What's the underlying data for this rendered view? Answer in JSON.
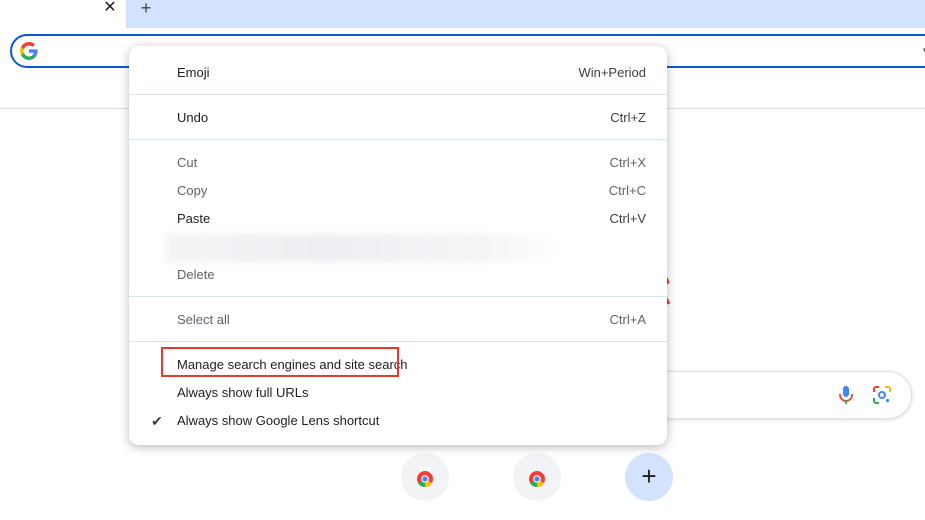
{
  "tabstrip": {
    "close_glyph": "✕",
    "new_tab_glyph": "+"
  },
  "omnibox": {
    "caret_glyph": "▾"
  },
  "shortcuts": {
    "add_glyph": "+"
  },
  "context_menu": {
    "items": [
      {
        "label": "Emoji",
        "shortcut": "Win+Period",
        "enabled": true
      },
      {
        "label": "Undo",
        "shortcut": "Ctrl+Z",
        "enabled": true
      },
      {
        "label": "Cut",
        "shortcut": "Ctrl+X",
        "enabled": false
      },
      {
        "label": "Copy",
        "shortcut": "Ctrl+C",
        "enabled": false
      },
      {
        "label": "Paste",
        "shortcut": "Ctrl+V",
        "enabled": true
      },
      {
        "label": "Delete",
        "shortcut": "",
        "enabled": false
      },
      {
        "label": "Select all",
        "shortcut": "Ctrl+A",
        "enabled": false
      },
      {
        "label": "Manage search engines and site search",
        "shortcut": "",
        "enabled": true,
        "highlighted": true
      },
      {
        "label": "Always show full URLs",
        "shortcut": "",
        "enabled": true
      },
      {
        "label": "Always show Google Lens shortcut",
        "shortcut": "",
        "enabled": true,
        "checked": true
      }
    ],
    "check_glyph": "✔"
  },
  "colors": {
    "highlight": "#e53935",
    "accent": "#0b57d0",
    "tab_strip": "#d3e3fd"
  },
  "icons": [
    "close-icon",
    "plus-icon",
    "google-g-icon",
    "chevron-down-icon",
    "microphone-icon",
    "google-lens-icon",
    "chrome-icon",
    "checkmark-icon"
  ]
}
